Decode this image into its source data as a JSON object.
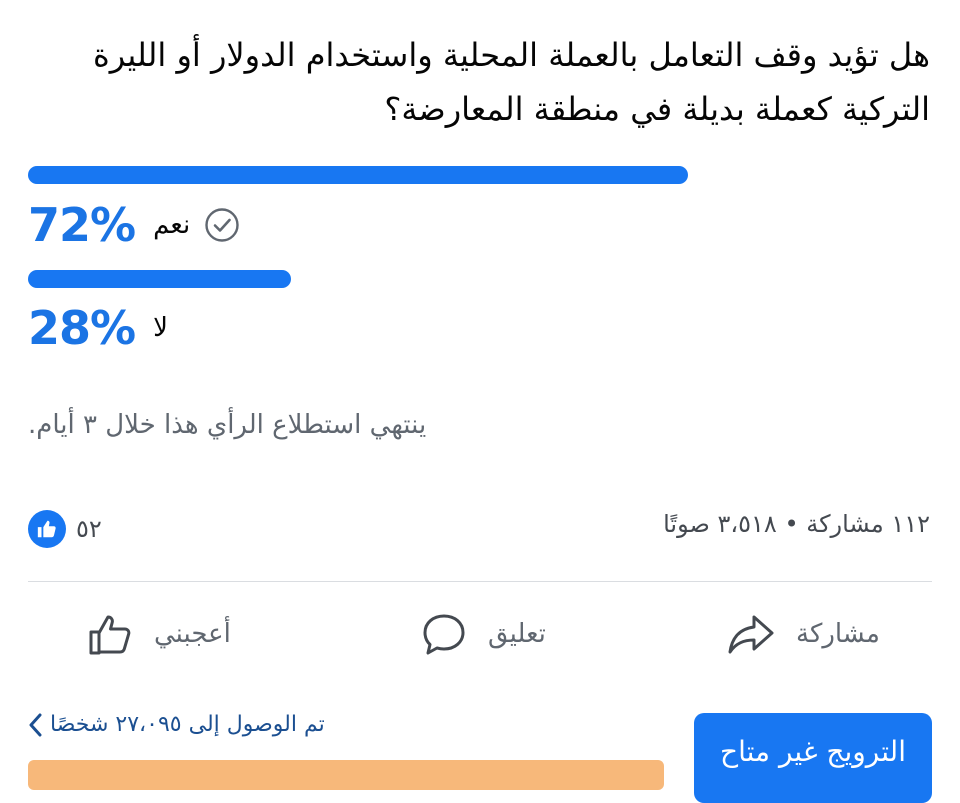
{
  "poll": {
    "question": "هل تؤيد وقف التعامل بالعملة المحلية واستخدام الدولار أو الليرة التركية كعملة بديلة في منطقة المعارضة؟",
    "options": [
      {
        "label": "نعم",
        "percent_text": "72%",
        "percent": 72,
        "selected": true
      },
      {
        "label": "لا",
        "percent_text": "28%",
        "percent": 28,
        "selected": false
      }
    ],
    "ends_text": "ينتهي استطلاع الرأي هذا خلال ٣ أيام."
  },
  "engagement": {
    "likes_count": "٥٢",
    "stats_text": "١١٢ مشاركة • ٣،٥١٨ صوتًا"
  },
  "actions": {
    "like_label": "أعجبني",
    "comment_label": "تعليق",
    "share_label": "مشاركة"
  },
  "promotion": {
    "reach_text": "تم الوصول إلى ٢٧،٠٩٥ شخصًا",
    "boost_label": "الترويج غير متاح"
  },
  "colors": {
    "accent": "#1877f2",
    "percent_text": "#1b74e4",
    "reach_bar": "#f7b87a"
  }
}
